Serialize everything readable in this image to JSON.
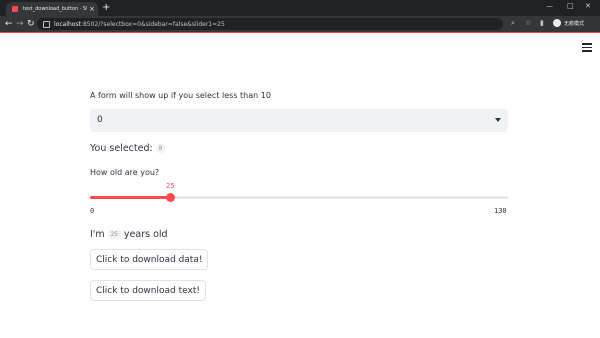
{
  "browser": {
    "tab_title": "test_download_button · Strea…",
    "tab_close": "×",
    "new_tab": "+",
    "url_host": "localhost",
    "url_rest": ":8502/?selectbox=0&sidebar=false&slider1=25",
    "profile_label": "无痕模式",
    "win_min": "—",
    "win_max": "□",
    "win_close": "✕"
  },
  "main": {
    "select_label": "A form will show up if you select less than 10",
    "select_value": "0",
    "selected_prefix": "You selected:",
    "selected_value": "0",
    "age_label": "How old are you?",
    "slider": {
      "value": 25,
      "min": 0,
      "max": 130,
      "value_text": "25",
      "min_text": "0",
      "max_text": "130"
    },
    "age_prefix": "I'm",
    "age_value": "25",
    "age_suffix": "years old",
    "download_data_label": "Click to download data!",
    "download_text_label": "Click to download text!"
  },
  "colors": {
    "accent": "#ff4b4b",
    "text": "#31333f",
    "select_bg": "#f0f2f6"
  }
}
